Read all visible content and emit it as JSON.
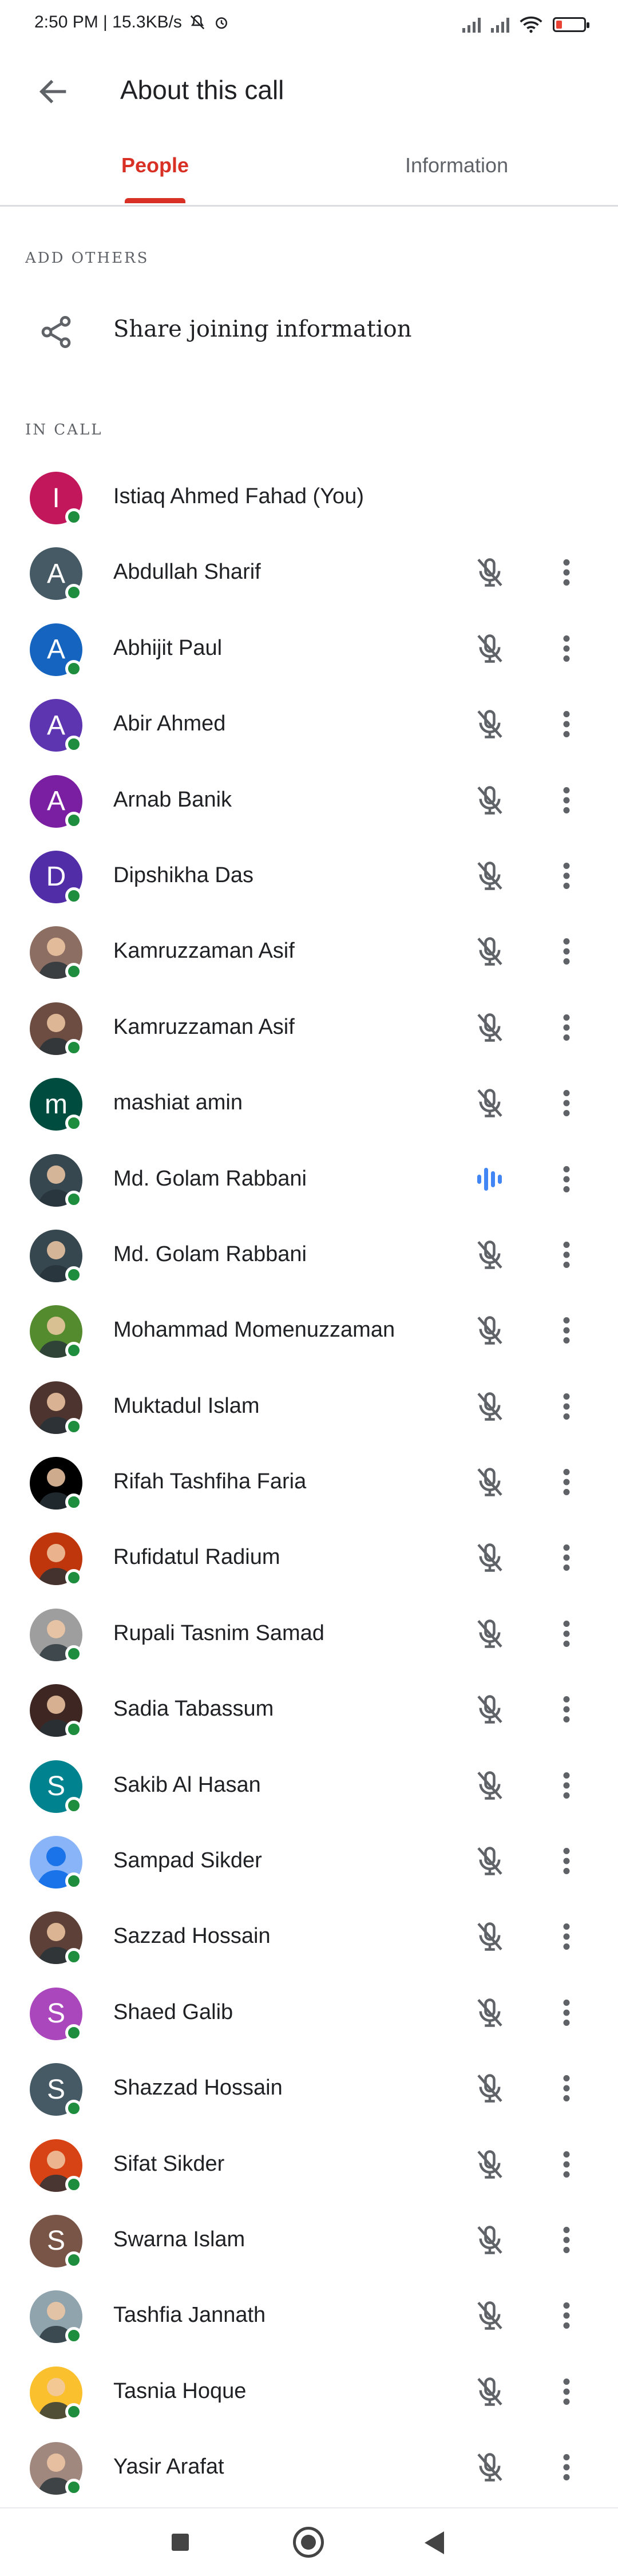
{
  "status_bar": {
    "time_speed": "2:50 PM | 15.3KB/s"
  },
  "app_bar": {
    "title": "About this call"
  },
  "tabs": [
    {
      "label": "People"
    },
    {
      "label": "Information"
    }
  ],
  "add_others": {
    "heading": "ADD OTHERS",
    "share_label": "Share joining information"
  },
  "in_call": {
    "heading": "IN CALL",
    "participants": [
      {
        "name": "Istiaq Ahmed Fahad (You)",
        "avatar": "I",
        "color": "#c2185b",
        "mic": "none"
      },
      {
        "name": "Abdullah Sharif",
        "avatar": "A",
        "color": "#455a64",
        "mic": "muted"
      },
      {
        "name": "Abhijit Paul",
        "avatar": "A",
        "color": "#1565c0",
        "mic": "muted"
      },
      {
        "name": "Abir Ahmed",
        "avatar": "A",
        "color": "#5e35b1",
        "mic": "muted"
      },
      {
        "name": "Arnab Banik",
        "avatar": "A",
        "color": "#7b1fa2",
        "mic": "muted"
      },
      {
        "name": "Dipshikha Das",
        "avatar": "D",
        "color": "#512da8",
        "mic": "muted"
      },
      {
        "name": "Kamruzzaman Asif",
        "avatar": "photo",
        "color": "#8d6e63",
        "mic": "muted"
      },
      {
        "name": "Kamruzzaman Asif",
        "avatar": "photo",
        "color": "#6d4c41",
        "mic": "muted"
      },
      {
        "name": "mashiat amin",
        "avatar": "m",
        "color": "#004d40",
        "mic": "muted"
      },
      {
        "name": "Md. Golam Rabbani",
        "avatar": "photo",
        "color": "#37474f",
        "mic": "speaking"
      },
      {
        "name": "Md. Golam Rabbani",
        "avatar": "photo",
        "color": "#37474f",
        "mic": "muted"
      },
      {
        "name": "Mohammad Momenuzzaman",
        "avatar": "photo",
        "color": "#558b2f",
        "mic": "muted"
      },
      {
        "name": "Muktadul Islam",
        "avatar": "photo",
        "color": "#4e342e",
        "mic": "muted"
      },
      {
        "name": "Rifah Tashfiha Faria",
        "avatar": "photo",
        "color": "#000000",
        "mic": "muted"
      },
      {
        "name": "Rufidatul Radium",
        "avatar": "photo",
        "color": "#bf360c",
        "mic": "muted"
      },
      {
        "name": "Rupali Tasnim Samad",
        "avatar": "photo",
        "color": "#9e9e9e",
        "mic": "muted"
      },
      {
        "name": "Sadia Tabassum",
        "avatar": "photo",
        "color": "#3e2723",
        "mic": "muted"
      },
      {
        "name": "Sakib Al Hasan",
        "avatar": "S",
        "color": "#00838f",
        "mic": "muted"
      },
      {
        "name": "Sampad Sikder",
        "avatar": "default",
        "color": "#8ab4f8",
        "mic": "muted"
      },
      {
        "name": "Sazzad Hossain",
        "avatar": "photo",
        "color": "#5d4037",
        "mic": "muted"
      },
      {
        "name": "Shaed Galib",
        "avatar": "S",
        "color": "#ab47bc",
        "mic": "muted"
      },
      {
        "name": "Shazzad Hossain",
        "avatar": "S",
        "color": "#455a64",
        "mic": "muted"
      },
      {
        "name": "Sifat Sikder",
        "avatar": "photo",
        "color": "#d84315",
        "mic": "muted"
      },
      {
        "name": "Swarna Islam",
        "avatar": "S",
        "color": "#795548",
        "mic": "muted"
      },
      {
        "name": "Tashfia Jannath",
        "avatar": "photo",
        "color": "#90a4ae",
        "mic": "muted"
      },
      {
        "name": "Tasnia Hoque",
        "avatar": "photo",
        "color": "#fbc02d",
        "mic": "muted"
      },
      {
        "name": "Yasir Arafat",
        "avatar": "photo",
        "color": "#a1887f",
        "mic": "muted"
      }
    ]
  },
  "colors": {
    "accent": "#d93025",
    "online": "#1e8e3e",
    "speaking": "#4285f4",
    "icon": "#5f6368"
  }
}
